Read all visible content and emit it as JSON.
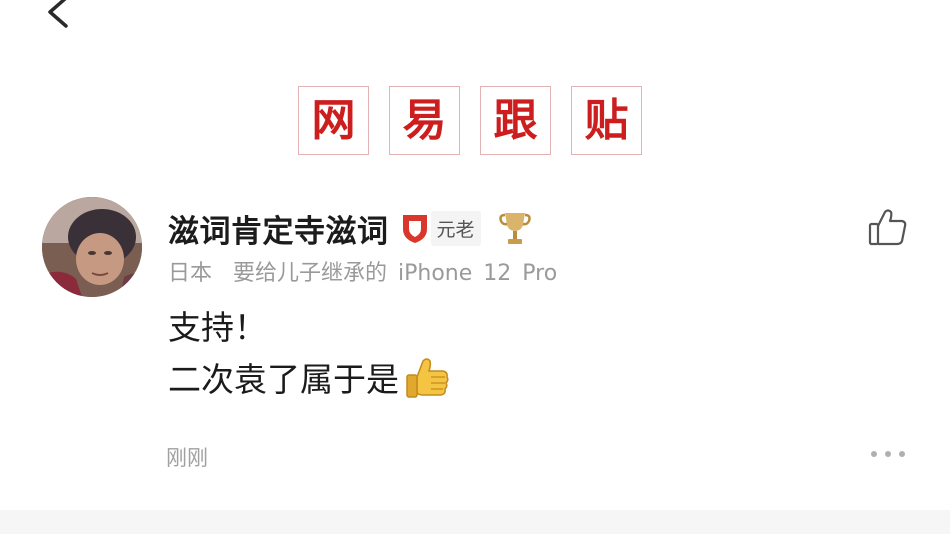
{
  "header": {
    "back_icon": "chevron-left-icon",
    "title_chars": [
      "网",
      "易",
      "跟",
      "贴"
    ],
    "title_color": "#cc1e1e"
  },
  "comment": {
    "avatar": "user-avatar-photo",
    "username": "滋词肯定寺滋词",
    "badge_icon": "shield-badge-icon",
    "badge_color": "#d9362c",
    "level": "元老",
    "trophy_icon": "trophy-icon",
    "location": "日本",
    "device": "要给儿子继承的 iPhone 12 Pro",
    "body_line1": "支持！",
    "body_line2": "二次袁了属于是",
    "body_emoji": "thumbs-up-emoji",
    "time": "刚刚",
    "like_icon": "thumbs-up-outline-icon",
    "more_icon": "more-dots-icon"
  }
}
